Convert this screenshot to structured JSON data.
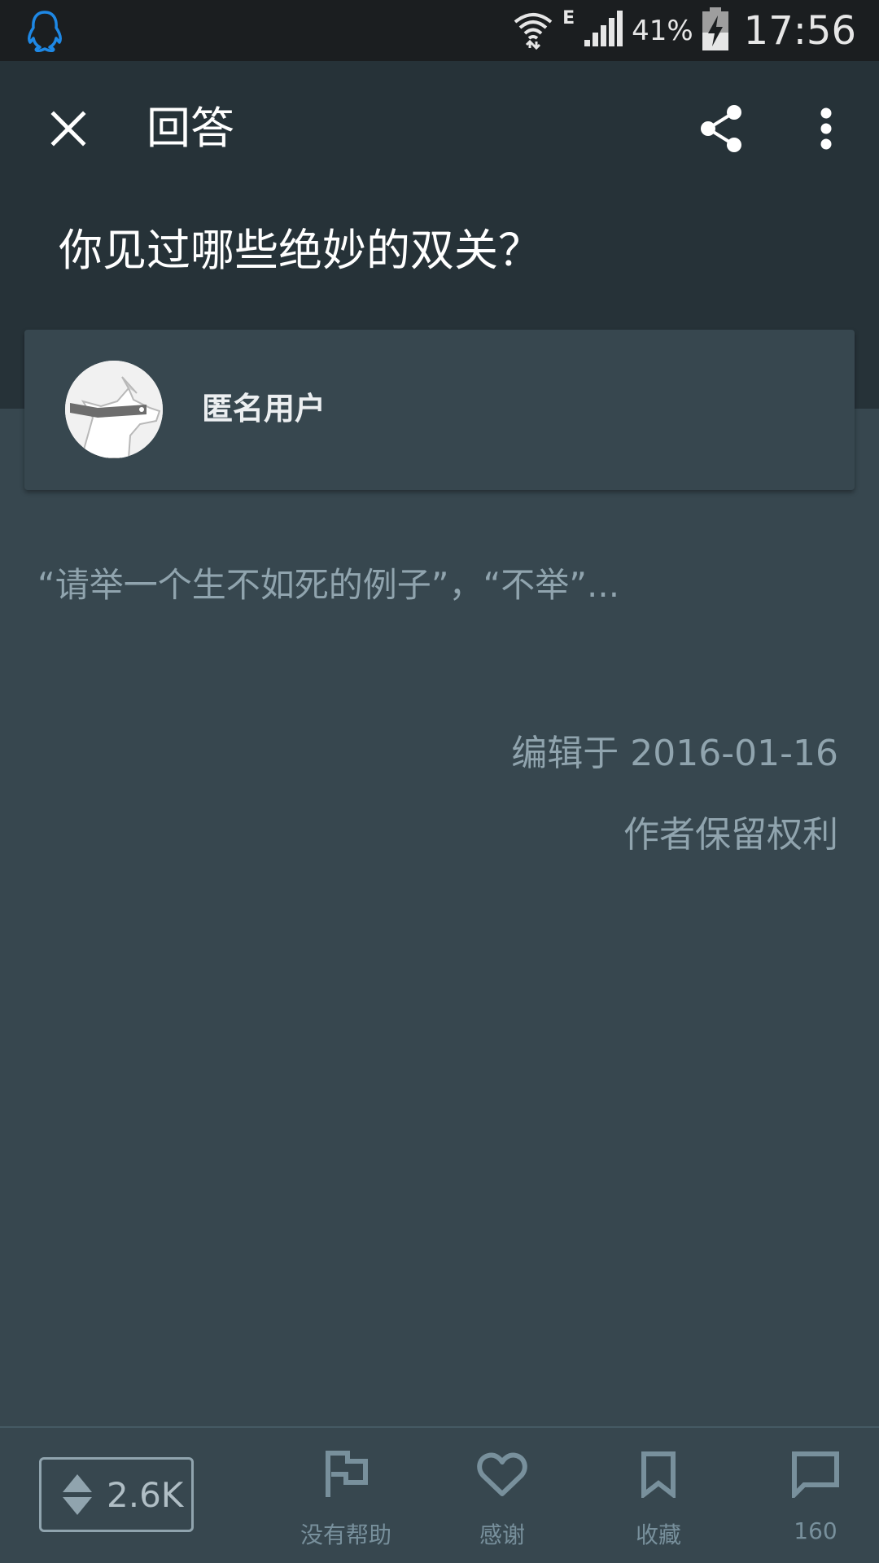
{
  "status_bar": {
    "network_type": "E",
    "battery_percent": "41%",
    "time": "17:56"
  },
  "app_bar": {
    "title": "回答",
    "question": "你见过哪些绝妙的双关？"
  },
  "author": {
    "name": "匿名用户"
  },
  "answer": {
    "excerpt": "“请举一个生不如死的例子”，“不举”...",
    "edit_info": "编辑于 2016-01-16",
    "rights": "作者保留权利"
  },
  "bottom_bar": {
    "vote_count": "2.6K",
    "actions": [
      {
        "label": "没有帮助",
        "icon": "flag-icon"
      },
      {
        "label": "感谢",
        "icon": "heart-icon"
      },
      {
        "label": "收藏",
        "icon": "bookmark-icon"
      },
      {
        "label": "160",
        "icon": "comment-icon"
      }
    ]
  },
  "colors": {
    "status_bar_bg": "#1b1e20",
    "app_bar_bg": "#263238",
    "content_bg": "#37474f",
    "secondary_text": "#90a4ae",
    "notification_icon": "#1e88e5"
  }
}
